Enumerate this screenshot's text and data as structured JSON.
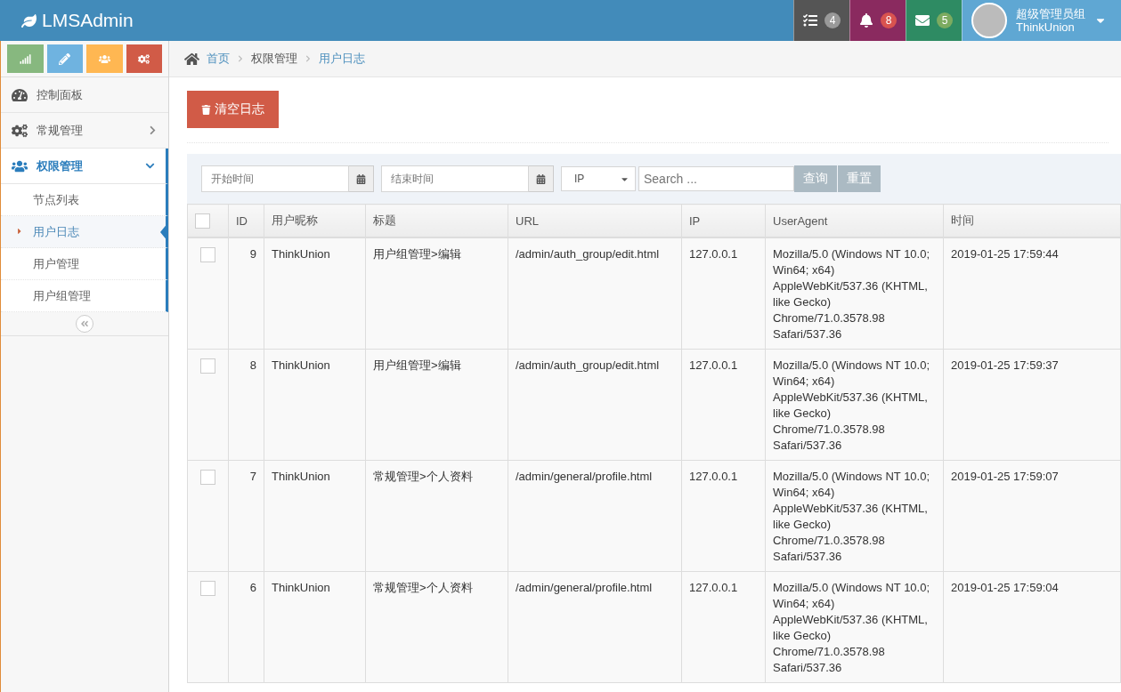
{
  "brand": {
    "title": "LMSAdmin"
  },
  "header": {
    "badges": [
      {
        "kind": "tasks",
        "count": "4"
      },
      {
        "kind": "bell",
        "count": "8"
      },
      {
        "kind": "mail",
        "count": "5"
      }
    ],
    "user": {
      "group": "超级管理员组",
      "name": "ThinkUnion"
    }
  },
  "shortcuts": [
    {
      "kind": "chart"
    },
    {
      "kind": "pencil"
    },
    {
      "kind": "users"
    },
    {
      "kind": "gears"
    }
  ],
  "sidebar": {
    "items": [
      {
        "label": "控制面板",
        "selected": false
      },
      {
        "label": "常规管理",
        "expanded": false,
        "selected": false
      },
      {
        "label": "权限管理",
        "expanded": true,
        "selected": true,
        "children": [
          {
            "label": "节点列表",
            "selected": false
          },
          {
            "label": "用户日志",
            "selected": true
          },
          {
            "label": "用户管理",
            "selected": false
          },
          {
            "label": "用户组管理",
            "selected": false
          }
        ]
      }
    ]
  },
  "breadcrumb": [
    {
      "label": "首页",
      "link": true
    },
    {
      "label": "权限管理",
      "link": false
    },
    {
      "label": "用户日志",
      "link": true
    }
  ],
  "toolbar": {
    "clear_button": "清空日志"
  },
  "filters": {
    "start_placeholder": "开始时间",
    "end_placeholder": "结束时间",
    "field_select": "IP",
    "search_placeholder": "Search ...",
    "query_button": "查询",
    "reset_button": "重置"
  },
  "table": {
    "all_checked": false,
    "columns": [
      "ID",
      "用户昵称",
      "标题",
      "URL",
      "IP",
      "UserAgent",
      "时间"
    ],
    "rows": [
      {
        "checked": false,
        "cells": [
          "9",
          "ThinkUnion",
          "用户组管理>编辑",
          "/admin/auth_group/edit.html",
          "127.0.0.1",
          "Mozilla/5.0 (Windows NT 10.0; Win64; x64) AppleWebKit/537.36 (KHTML, like Gecko) Chrome/71.0.3578.98 Safari/537.36",
          "2019-01-25 17:59:44"
        ]
      },
      {
        "checked": false,
        "cells": [
          "8",
          "ThinkUnion",
          "用户组管理>编辑",
          "/admin/auth_group/edit.html",
          "127.0.0.1",
          "Mozilla/5.0 (Windows NT 10.0; Win64; x64) AppleWebKit/537.36 (KHTML, like Gecko) Chrome/71.0.3578.98 Safari/537.36",
          "2019-01-25 17:59:37"
        ]
      },
      {
        "checked": false,
        "cells": [
          "7",
          "ThinkUnion",
          "常规管理>个人资料",
          "/admin/general/profile.html",
          "127.0.0.1",
          "Mozilla/5.0 (Windows NT 10.0; Win64; x64) AppleWebKit/537.36 (KHTML, like Gecko) Chrome/71.0.3578.98 Safari/537.36",
          "2019-01-25 17:59:07"
        ]
      },
      {
        "checked": false,
        "cells": [
          "6",
          "ThinkUnion",
          "常规管理>个人资料",
          "/admin/general/profile.html",
          "127.0.0.1",
          "Mozilla/5.0 (Windows NT 10.0; Win64; x64) AppleWebKit/537.36 (KHTML, like Gecko) Chrome/71.0.3578.98 Safari/537.36",
          "2019-01-25 17:59:04"
        ]
      }
    ]
  }
}
